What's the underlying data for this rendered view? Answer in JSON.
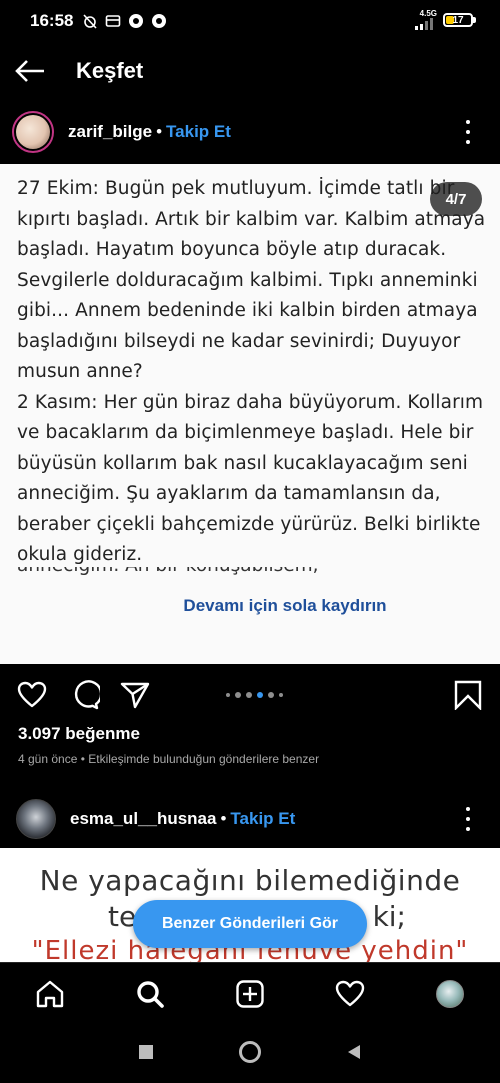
{
  "status_bar": {
    "time": "16:58",
    "network": "4.5G",
    "battery": "17"
  },
  "header": {
    "title": "Keşfet"
  },
  "post": {
    "username": "zarif_bilge",
    "separator": "•",
    "follow_label": "Takip Et",
    "page_indicator": "4/7",
    "text": "27 Ekim: Bugün pek mutluyum. İçimde tatlı bir\nkıpırtı başladı. Artık bir kalbim var. Kalbim atmaya\nbaşladı. Hayatım boyunca böyle atıp duracak.\nSevgilerle dolduracağım kalbimi. Tıpkı anneminki\ngibi... Annem bedeninde iki kalbin birden atmaya\nbaşladığını bilseydi ne kadar sevinirdi; Duyuyor\nmusun anne?\n2 Kasım: Her gün biraz daha büyüyorum. Kollarım\nve bacaklarım da biçimlenmeye başladı. Hele bir\nbüyüsün kollarım bak nasıl kucaklayacağım seni\nanneciğim. Şu ayaklarım da tamamlansın da,\nberaber çiçekli bahçemizde yürürüz. Belki birlikte\nokula gideriz.",
    "cut_line": "anneciğim. Ah bir konuşabilsem,",
    "swipe_hint": "Devamı için sola kaydırın",
    "carousel_current": 4,
    "carousel_total": 7,
    "likes": "3.097 beğenme",
    "meta": "4 gün önce • Etkileşimde bulunduğun gönderilere benzer"
  },
  "post2": {
    "username": "esma_ul__husnaa",
    "separator": "•",
    "follow_label": "Takip Et",
    "line1": "Ne yapacağını bilemediğinde",
    "line2_left": "te",
    "line2_right": "ki;",
    "line3": "\"Ellezi halegani fehuve yehdin\""
  },
  "similar_button": "Benzer Gönderileri Gör",
  "icons": {
    "back": "arrow-left-icon",
    "more": "more-vertical-icon",
    "like": "heart-icon",
    "comment": "comment-icon",
    "share": "send-icon",
    "save": "bookmark-icon",
    "home": "home-icon",
    "search": "search-icon",
    "create": "plus-square-icon",
    "activity": "heart-icon"
  },
  "colors": {
    "accent": "#3897f0",
    "background": "#000000",
    "hint_blue": "#1f4f9a"
  }
}
